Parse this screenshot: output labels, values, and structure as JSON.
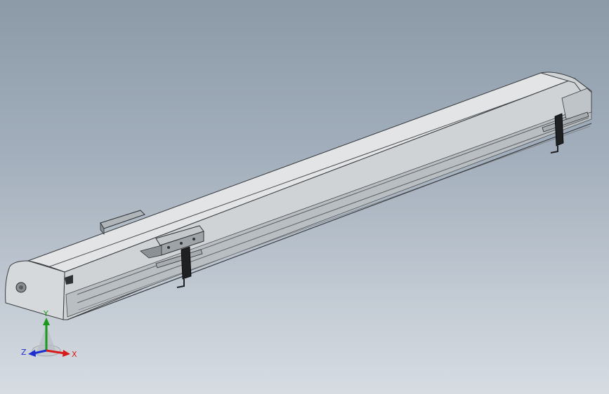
{
  "viewport": {
    "background_top": "#8c9aa8",
    "background_bottom": "#d6dce2"
  },
  "model": {
    "body_color": "#d9dcde",
    "edge_color": "#3a3d40",
    "shadow_color": "#9ea3a7",
    "bracket_color": "#7d8286",
    "clamp_color": "#1e2022"
  },
  "triad": {
    "x_label": "X",
    "y_label": "Y",
    "z_label": "Z",
    "x_color": "#d81c1c",
    "y_color": "#1a9a1a",
    "z_color": "#1c2fd0"
  }
}
